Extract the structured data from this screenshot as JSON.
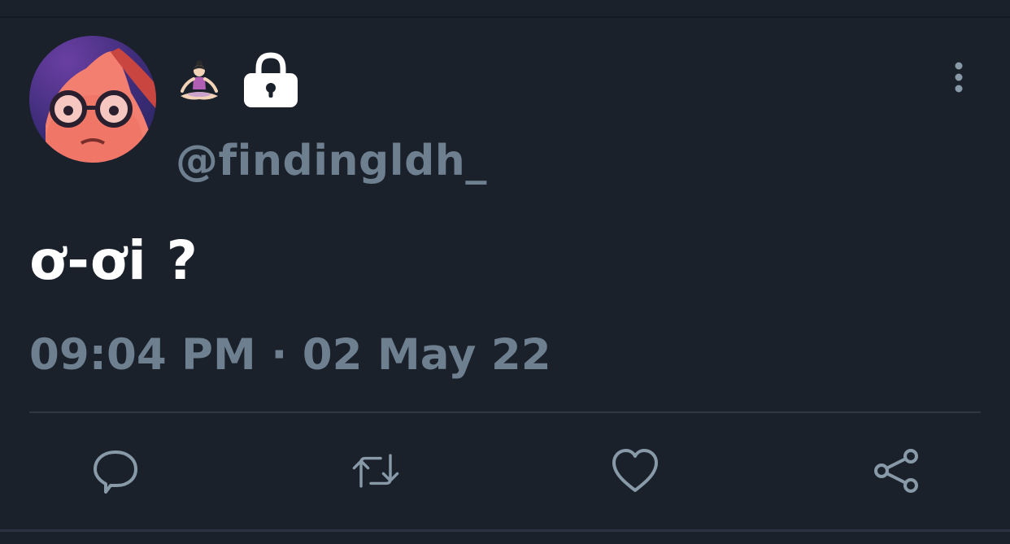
{
  "tweet": {
    "handle": "@findingldh_",
    "text": "ơ-ơi ?",
    "timestamp": "09:04 PM · 02 May 22"
  },
  "icons": {
    "name_emoji": "person-in-lotus-position-emoji",
    "protected": "lock-icon",
    "more": "more-vertical-icon",
    "actions": [
      "reply-icon",
      "retweet-icon",
      "like-icon",
      "share-icon"
    ]
  },
  "colors": {
    "background": "#1a212b",
    "primary_text": "#ffffff",
    "secondary_text": "#6e7f90",
    "icon": "#8899a8"
  }
}
